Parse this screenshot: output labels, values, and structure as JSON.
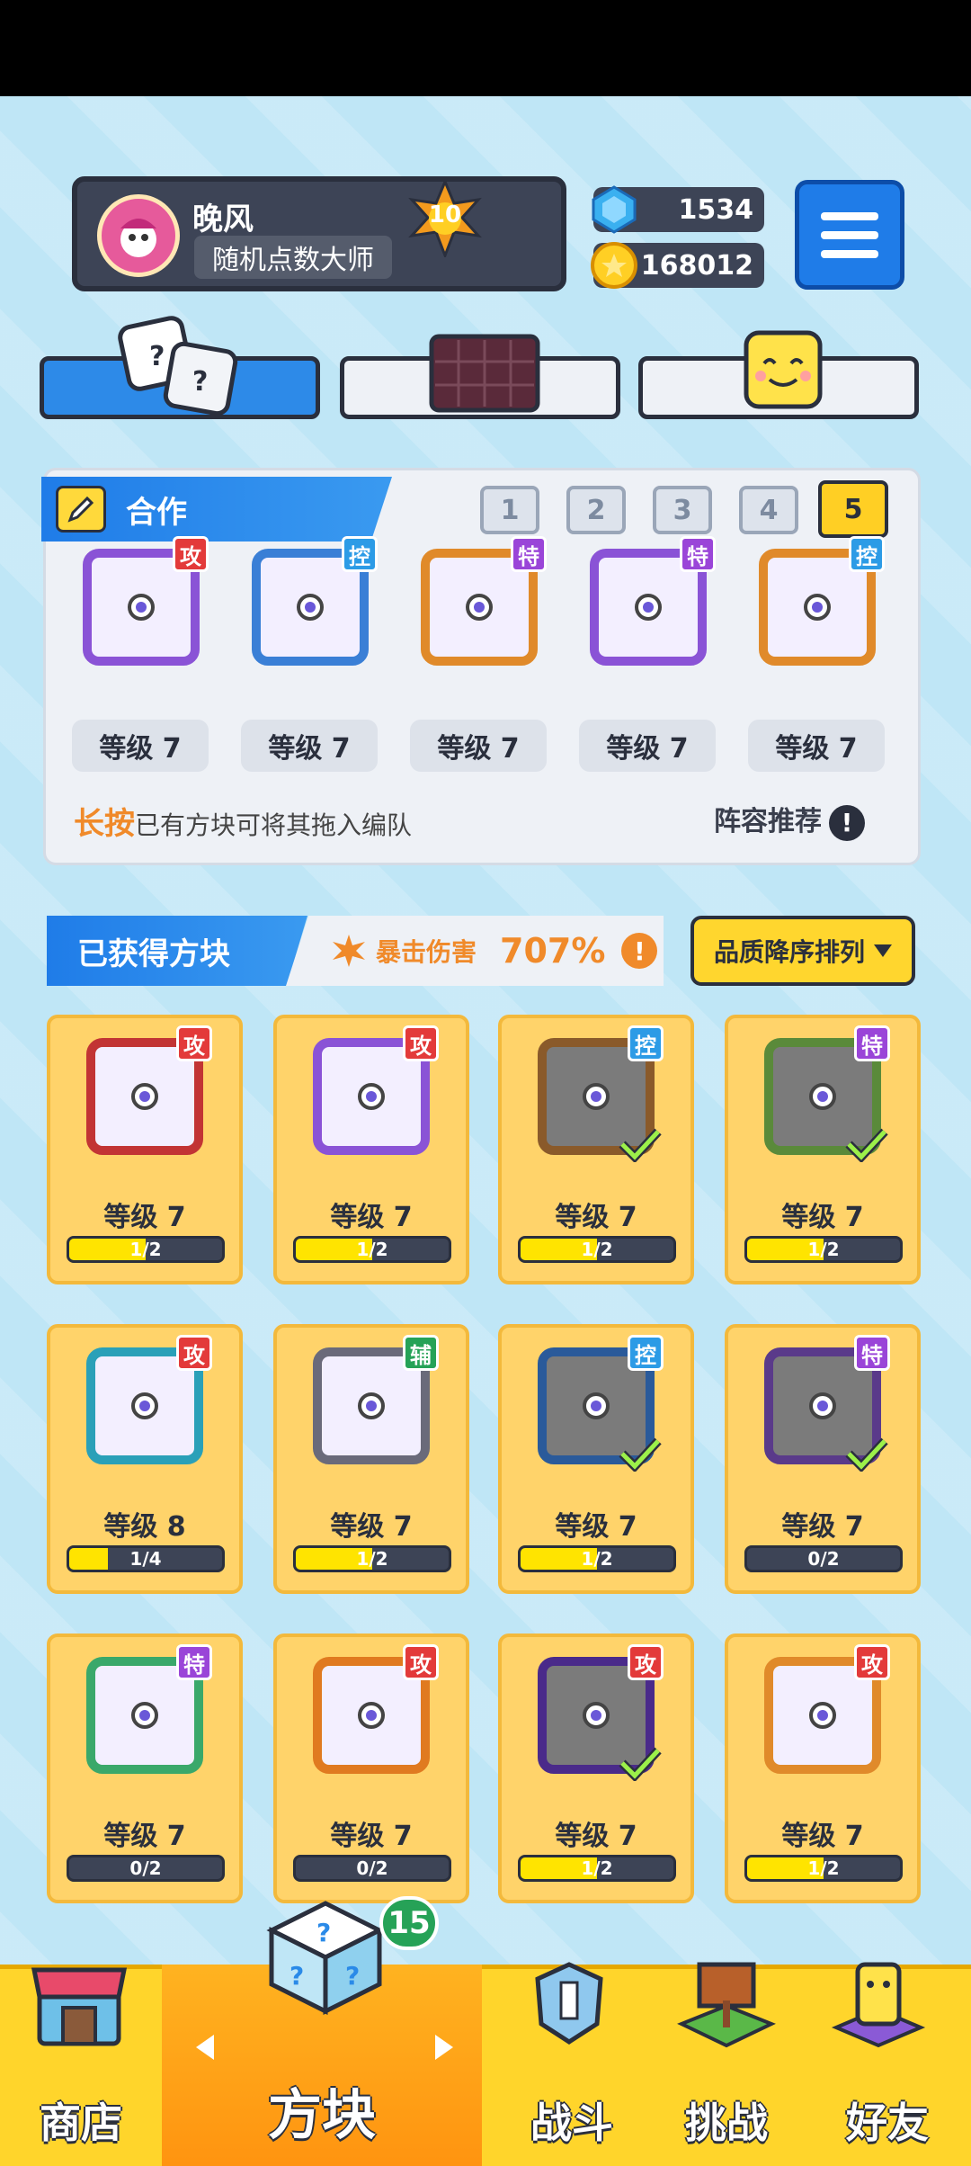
{
  "profile": {
    "name": "晚风",
    "title": "随机点数大师",
    "level": "10"
  },
  "currency": {
    "gems": "1534",
    "coins": "168012"
  },
  "team": {
    "title": "合作",
    "tabs": [
      "1",
      "2",
      "3",
      "4",
      "5"
    ],
    "active_tab": "5",
    "blocks": [
      {
        "tag": "攻",
        "level": "等级 7",
        "color": "#8a53d6"
      },
      {
        "tag": "控",
        "level": "等级 7",
        "color": "#3a7fd6"
      },
      {
        "tag": "特",
        "level": "等级 7",
        "color": "#e08a2a"
      },
      {
        "tag": "特",
        "level": "等级 7",
        "color": "#8a53d6"
      },
      {
        "tag": "控",
        "level": "等级 7",
        "color": "#e08a2a"
      }
    ],
    "hint_bold": "长按",
    "hint_rest": "已有方块可将其拖入编队",
    "recommend": "阵容推荐",
    "excl": "!"
  },
  "owned": {
    "title": "已获得方块",
    "crit_label": "暴击伤害",
    "crit_value": "707%",
    "sort_label": "品质降序排列",
    "cards": [
      {
        "tag": "攻",
        "level": "等级 7",
        "progress": "1/2",
        "fill": 0.5,
        "color": "#c23434",
        "check": false,
        "dim": false
      },
      {
        "tag": "攻",
        "level": "等级 7",
        "progress": "1/2",
        "fill": 0.5,
        "color": "#8a53d6",
        "check": false,
        "dim": false
      },
      {
        "tag": "控",
        "level": "等级 7",
        "progress": "1/2",
        "fill": 0.5,
        "color": "#8a5a2a",
        "check": true,
        "dim": true
      },
      {
        "tag": "特",
        "level": "等级 7",
        "progress": "1/2",
        "fill": 0.5,
        "color": "#5a8a3a",
        "check": true,
        "dim": true
      },
      {
        "tag": "攻",
        "level": "等级 8",
        "progress": "1/4",
        "fill": 0.25,
        "color": "#2aa0b8",
        "check": false,
        "dim": false
      },
      {
        "tag": "辅",
        "level": "等级 7",
        "progress": "1/2",
        "fill": 0.5,
        "color": "#6a6a7a",
        "check": false,
        "dim": false
      },
      {
        "tag": "控",
        "level": "等级 7",
        "progress": "1/2",
        "fill": 0.5,
        "color": "#2a5a9a",
        "check": true,
        "dim": true
      },
      {
        "tag": "特",
        "level": "等级 7",
        "progress": "0/2",
        "fill": 0,
        "color": "#5a3a8a",
        "check": true,
        "dim": true
      },
      {
        "tag": "特",
        "level": "等级 7",
        "progress": "0/2",
        "fill": 0,
        "color": "#3aa86a",
        "check": false,
        "dim": false
      },
      {
        "tag": "攻",
        "level": "等级 7",
        "progress": "0/2",
        "fill": 0,
        "color": "#e07a20",
        "check": false,
        "dim": false
      },
      {
        "tag": "攻",
        "level": "等级 7",
        "progress": "1/2",
        "fill": 0.5,
        "color": "#4a2a8a",
        "check": true,
        "dim": true
      },
      {
        "tag": "攻",
        "level": "等级 7",
        "progress": "1/2",
        "fill": 0.5,
        "color": "#e08a2a",
        "check": false,
        "dim": false
      }
    ]
  },
  "nav": {
    "shop": "商店",
    "blocks": "方块",
    "battle": "战斗",
    "challenge": "挑战",
    "friends": "好友",
    "blocks_badge": "15"
  },
  "icons": {
    "gem": "gem-icon",
    "coin": "coin-icon",
    "menu": "hamburger-menu-icon",
    "dice": "dice-icon",
    "board": "board-icon",
    "face": "smiley-face-icon",
    "pencil": "pencil-icon",
    "check": "check-icon"
  }
}
